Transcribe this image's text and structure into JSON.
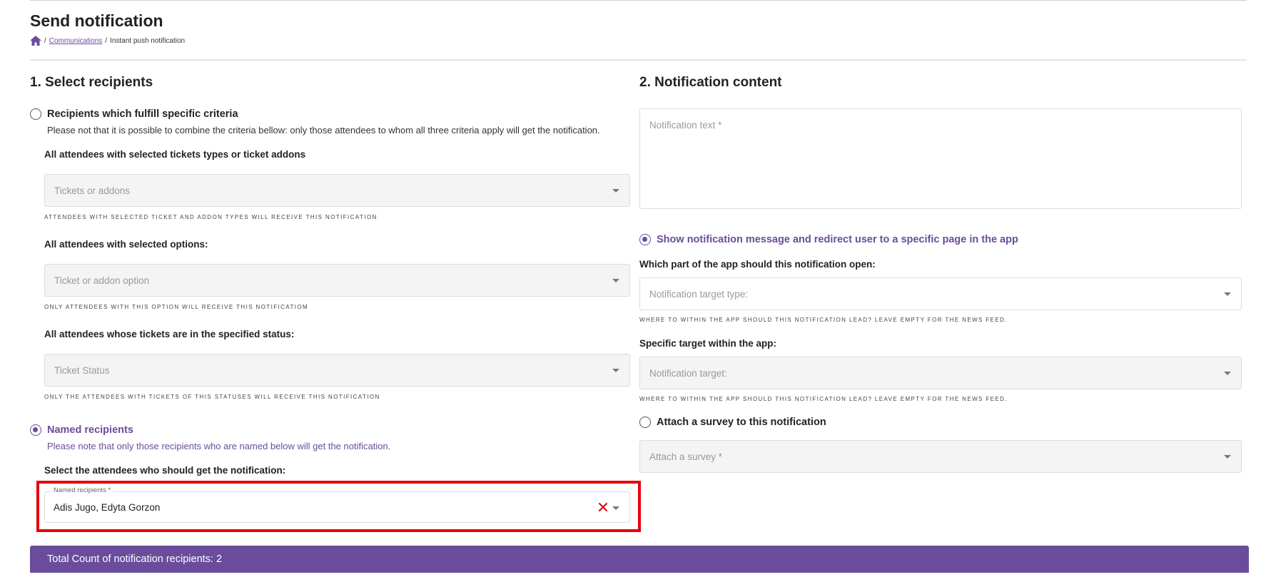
{
  "page": {
    "title": "Send notification",
    "breadcrumb": {
      "link": "Communications",
      "separator": "/",
      "current": "Instant push notification"
    }
  },
  "recipients": {
    "heading": "1. Select recipients",
    "criteria_option": {
      "label": "Recipients which fulfill specific criteria",
      "selected": false,
      "help": "Please not that it is possible to combine the criteria bellow: only those attendees to whom all three criteria apply will get the notification."
    },
    "tickets": {
      "label": "All attendees with selected tickets types or ticket addons",
      "placeholder": "Tickets or addons",
      "hint": "Attendees with selected ticket and addon types will receive this notification"
    },
    "options": {
      "label": "All attendees with selected options:",
      "placeholder": "Ticket or addon option",
      "hint": "Only attendees with this option will receive this notificatiom"
    },
    "status": {
      "label": "All attendees whose tickets are in the specified status:",
      "placeholder": "Ticket Status",
      "hint": "Only the attendees with tickets of this statuses will receive this notification"
    },
    "named_option": {
      "label": "Named recipients",
      "selected": true,
      "help": "Please note that only those recipients who are named below will get the notification."
    },
    "named": {
      "label": "Select the attendees who should get the notification:",
      "field_label": "Named recipients *",
      "value": "Adis Jugo, Edyta Gorzon"
    }
  },
  "content": {
    "heading": "2. Notification content",
    "text_placeholder": "Notification text *",
    "redirect_option": {
      "label": "Show notification message and redirect user to a specific page in the app",
      "selected": true
    },
    "target_type": {
      "label": "Which part of the app should this notification open:",
      "placeholder": "Notification target type:",
      "hint": "Where to within the app should this notification lead? Leave empty for the news feed."
    },
    "target": {
      "label": "Specific target within the app:",
      "placeholder": "Notification target:",
      "hint": "Where to within the app should this notification lead? Leave empty for the news feed."
    },
    "survey_option": {
      "label": "Attach a survey to this notification",
      "selected": false
    },
    "survey": {
      "placeholder": "Attach a survey *"
    }
  },
  "footer": {
    "total": "Total Count of notification recipients: 2"
  },
  "colors": {
    "accent": "#6a4c9c",
    "highlight": "#e8000e",
    "clear_icon": "#e00000"
  }
}
